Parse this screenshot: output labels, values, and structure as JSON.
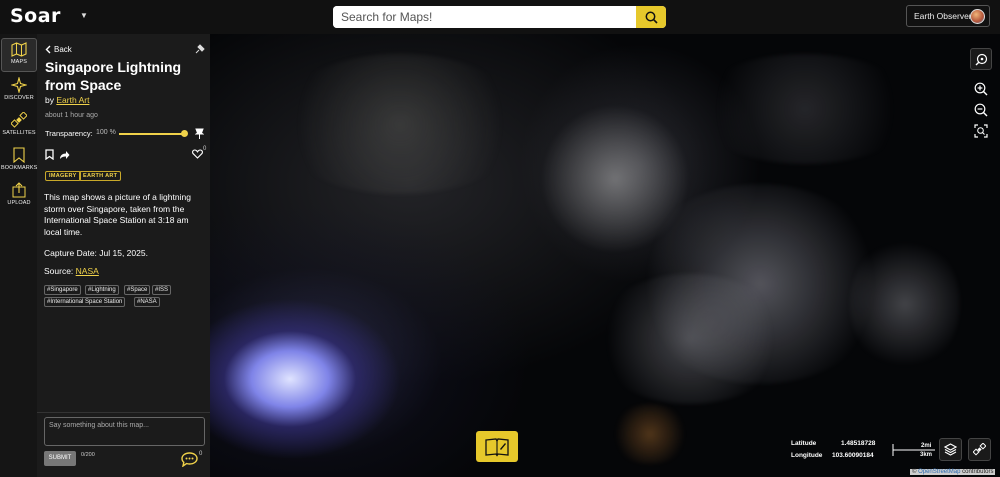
{
  "topbar": {
    "logo": "Soar",
    "search_placeholder": "Search for Maps!",
    "user_label": "Earth Observer"
  },
  "leftnav": {
    "items": [
      {
        "label": "MAPS",
        "icon": "map-icon",
        "active": true
      },
      {
        "label": "DISCOVER",
        "icon": "sparkle-icon",
        "active": false
      },
      {
        "label": "SATELLITES",
        "icon": "satellite-icon",
        "active": false
      },
      {
        "label": "BOOKMARKS",
        "icon": "bookmark-icon",
        "active": false
      },
      {
        "label": "UPLOAD",
        "icon": "upload-icon",
        "active": false
      }
    ]
  },
  "panel": {
    "back_label": "Back",
    "title": "Singapore Lightning from Space",
    "by_prefix": "by",
    "author": "Earth Art",
    "time": "about 1 hour ago",
    "transparency_label": "Transparency:",
    "transparency_value": "100 %",
    "transparency_level": 1.0,
    "like_count": "0",
    "categories": [
      "IMAGERY",
      "EARTH ART"
    ],
    "description": "This map shows a picture of a lightning storm over Singapore, taken from the International Space Station at 3:18 am local time.",
    "capture_date": "Capture Date: Jul 15, 2025.",
    "source_prefix": "Source:",
    "source_link": "NASA",
    "tags": [
      "#Singapore",
      "#Lightning",
      "#Space",
      "#ISS",
      "#International Space Station",
      "#NASA"
    ],
    "comment_placeholder": "Say something about this map...",
    "submit_label": "SUBMIT",
    "char_counter": "0/200",
    "comment_count": "0"
  },
  "map": {
    "latitude_label": "Latitude",
    "latitude_value": "1.48518728",
    "longitude_label": "Longitude",
    "longitude_value": "103.60090184",
    "scale_mi": "2mi",
    "scale_km": "3km",
    "attribution_symbol": "©",
    "attribution_link": "OpenStreetMap",
    "attribution_suffix": "contributors"
  },
  "colors": {
    "accent": "#e6c82b",
    "panel_bg": "#1b1b1b",
    "topbar_bg": "#111111"
  }
}
